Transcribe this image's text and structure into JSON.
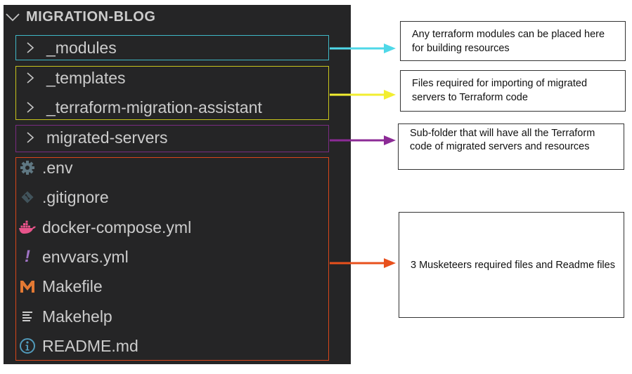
{
  "explorer": {
    "root_label": "MIGRATION-BLOG",
    "folders": [
      {
        "name": "_modules"
      },
      {
        "name": "_templates"
      },
      {
        "name": "_terraform-migration-assistant"
      },
      {
        "name": "migrated-servers"
      }
    ],
    "files": [
      {
        "name": ".env",
        "icon": "gear-icon"
      },
      {
        "name": ".gitignore",
        "icon": "git-icon"
      },
      {
        "name": "docker-compose.yml",
        "icon": "docker-whale-icon"
      },
      {
        "name": "envvars.yml",
        "icon": "yaml-exclamation-icon"
      },
      {
        "name": "Makefile",
        "icon": "makefile-m-icon"
      },
      {
        "name": "Makehelp",
        "icon": "text-lines-icon"
      },
      {
        "name": "README.md",
        "icon": "info-icon"
      }
    ]
  },
  "annotations": [
    {
      "group": "modules",
      "color": "#4fd8e8",
      "text": "Any terraform modules can be placed here for building resources"
    },
    {
      "group": "templates-assistant",
      "color": "#f2ee30",
      "text": "Files required for importing of migrated servers to Terraform code"
    },
    {
      "group": "migrated-servers",
      "color": "#8c2b96",
      "text": "Sub-folder that will have all the Terraform code of migrated servers and resources"
    },
    {
      "group": "root-files",
      "color": "#e8501c",
      "text": "3 Musketeers required files and Readme files"
    }
  ],
  "icon_colors": {
    "gear": "#5f7782",
    "git": "#41535b",
    "docker": "#e8548b",
    "yaml": "#a074c4",
    "makefile": "#e37933",
    "text": "#cccccc",
    "info": "#519aba"
  }
}
